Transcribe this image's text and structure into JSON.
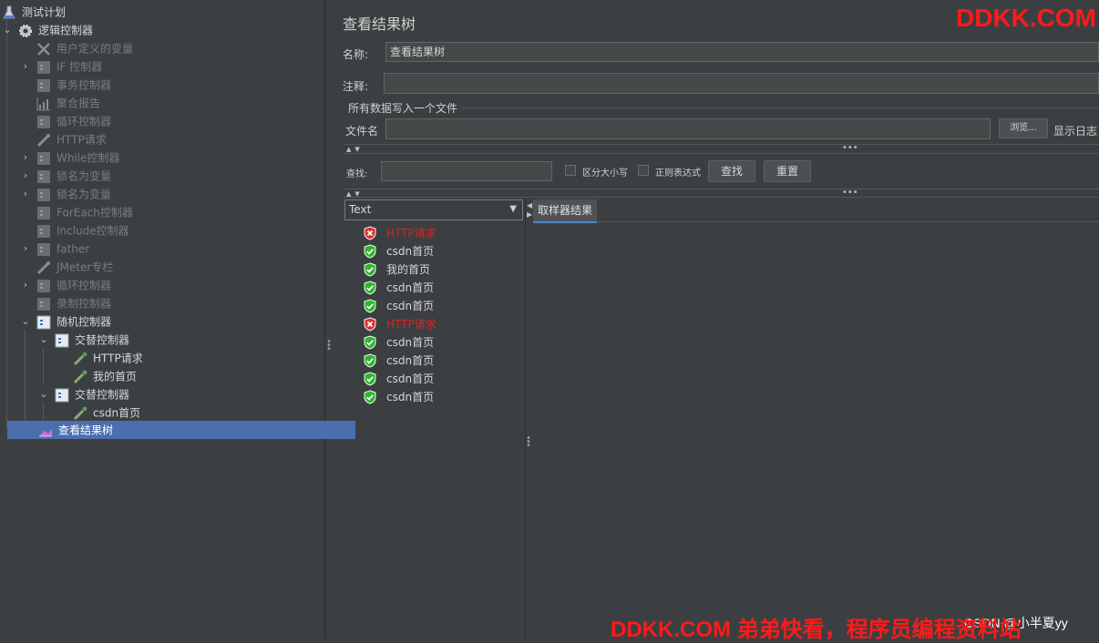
{
  "tree": {
    "items": [
      {
        "label": "测试计划",
        "icon": "flask-icon",
        "state": "active"
      },
      {
        "label": "逻辑控制器",
        "icon": "gear-icon",
        "state": "active"
      },
      {
        "label": "用户定义的变量",
        "icon": "wrench-icon",
        "state": "disabled"
      },
      {
        "label": "IF 控制器",
        "icon": "controller-icon",
        "state": "disabled"
      },
      {
        "label": "事务控制器",
        "icon": "controller-icon",
        "state": "disabled"
      },
      {
        "label": "聚合报告",
        "icon": "chart-icon",
        "state": "disabled"
      },
      {
        "label": "循环控制器",
        "icon": "controller-icon",
        "state": "disabled"
      },
      {
        "label": "HTTP请求",
        "icon": "pipette-icon",
        "state": "disabled"
      },
      {
        "label": "While控制器",
        "icon": "controller-icon",
        "state": "disabled"
      },
      {
        "label": "锁名为变量",
        "icon": "controller-icon",
        "state": "disabled"
      },
      {
        "label": "锁名为变量",
        "icon": "controller-icon",
        "state": "disabled"
      },
      {
        "label": "ForEach控制器",
        "icon": "controller-icon",
        "state": "disabled"
      },
      {
        "label": "Include控制器",
        "icon": "controller-icon",
        "state": "disabled"
      },
      {
        "label": "father",
        "icon": "controller-icon",
        "state": "disabled"
      },
      {
        "label": "JMeter专栏",
        "icon": "pipette-icon",
        "state": "disabled"
      },
      {
        "label": "循环控制器",
        "icon": "controller-icon",
        "state": "disabled"
      },
      {
        "label": "录制控制器",
        "icon": "controller-icon",
        "state": "disabled"
      },
      {
        "label": "随机控制器",
        "icon": "controller-icon",
        "state": "active"
      },
      {
        "label": "交替控制器",
        "icon": "controller-icon",
        "state": "active"
      },
      {
        "label": "HTTP请求",
        "icon": "pipette-icon",
        "state": "active"
      },
      {
        "label": "我的首页",
        "icon": "pipette-icon",
        "state": "active"
      },
      {
        "label": "交替控制器",
        "icon": "controller-icon",
        "state": "active"
      },
      {
        "label": "csdn首页",
        "icon": "pipette-icon",
        "state": "active"
      },
      {
        "label": "查看结果树",
        "icon": "listener-icon",
        "state": "selected"
      }
    ]
  },
  "panel": {
    "title": "查看结果树",
    "name_label": "名称:",
    "name_value": "查看结果树",
    "comment_label": "注释:",
    "comment_value": "",
    "file_section_label": "所有数据写入一个文件",
    "file_label": "文件名",
    "file_value": "",
    "browse_button": "浏览...",
    "log_label": "显示日志",
    "search_label": "查找:",
    "search_value": "",
    "case_sensitive_label": "区分大小写",
    "regex_label": "正则表达式",
    "find_button": "查找",
    "reset_button": "重置",
    "renderer_selected": "Text",
    "sampler_tab": "取样器结果"
  },
  "results": [
    {
      "label": "HTTP请求",
      "status": "error"
    },
    {
      "label": "csdn首页",
      "status": "ok"
    },
    {
      "label": "我的首页",
      "status": "ok"
    },
    {
      "label": "csdn首页",
      "status": "ok"
    },
    {
      "label": "csdn首页",
      "status": "ok"
    },
    {
      "label": "HTTP请求",
      "status": "error"
    },
    {
      "label": "csdn首页",
      "status": "ok"
    },
    {
      "label": "csdn首页",
      "status": "ok"
    },
    {
      "label": "csdn首页",
      "status": "ok"
    },
    {
      "label": "csdn首页",
      "status": "ok"
    }
  ],
  "watermark": {
    "top": "DDKK.COM",
    "bottom": "DDKK.COM 弟弟快看，程序员编程资料站",
    "under": "CSDN @小半夏yy"
  },
  "colors": {
    "background": "#3c3f41",
    "selection": "#4b6eaf",
    "error_text": "#e02020",
    "watermark": "#ff1a1a"
  }
}
